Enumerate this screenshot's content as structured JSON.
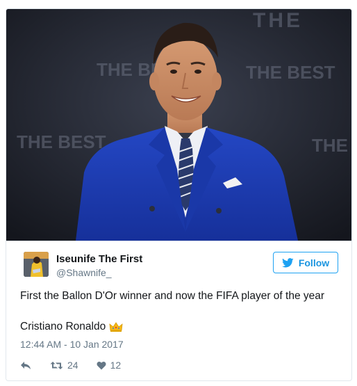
{
  "tweet": {
    "author": {
      "name": "Iseunife The First",
      "handle": "@Shawnife_"
    },
    "follow_label": "Follow",
    "text": "First the Ballon D'Or winner and now the FIFA player of the year",
    "subline": "Cristiano Ronaldo",
    "subline_emoji": "crown-icon",
    "timestamp": "12:44 AM - 10 Jan 2017",
    "retweet_count": "24",
    "like_count": "12",
    "photo_backdrop_text": "THE BEST",
    "photo_top_text": "THE"
  },
  "colors": {
    "accent": "#1da1f2",
    "follow_text": "#1b95e0",
    "muted": "#657786",
    "suit": "#1e3fae"
  }
}
